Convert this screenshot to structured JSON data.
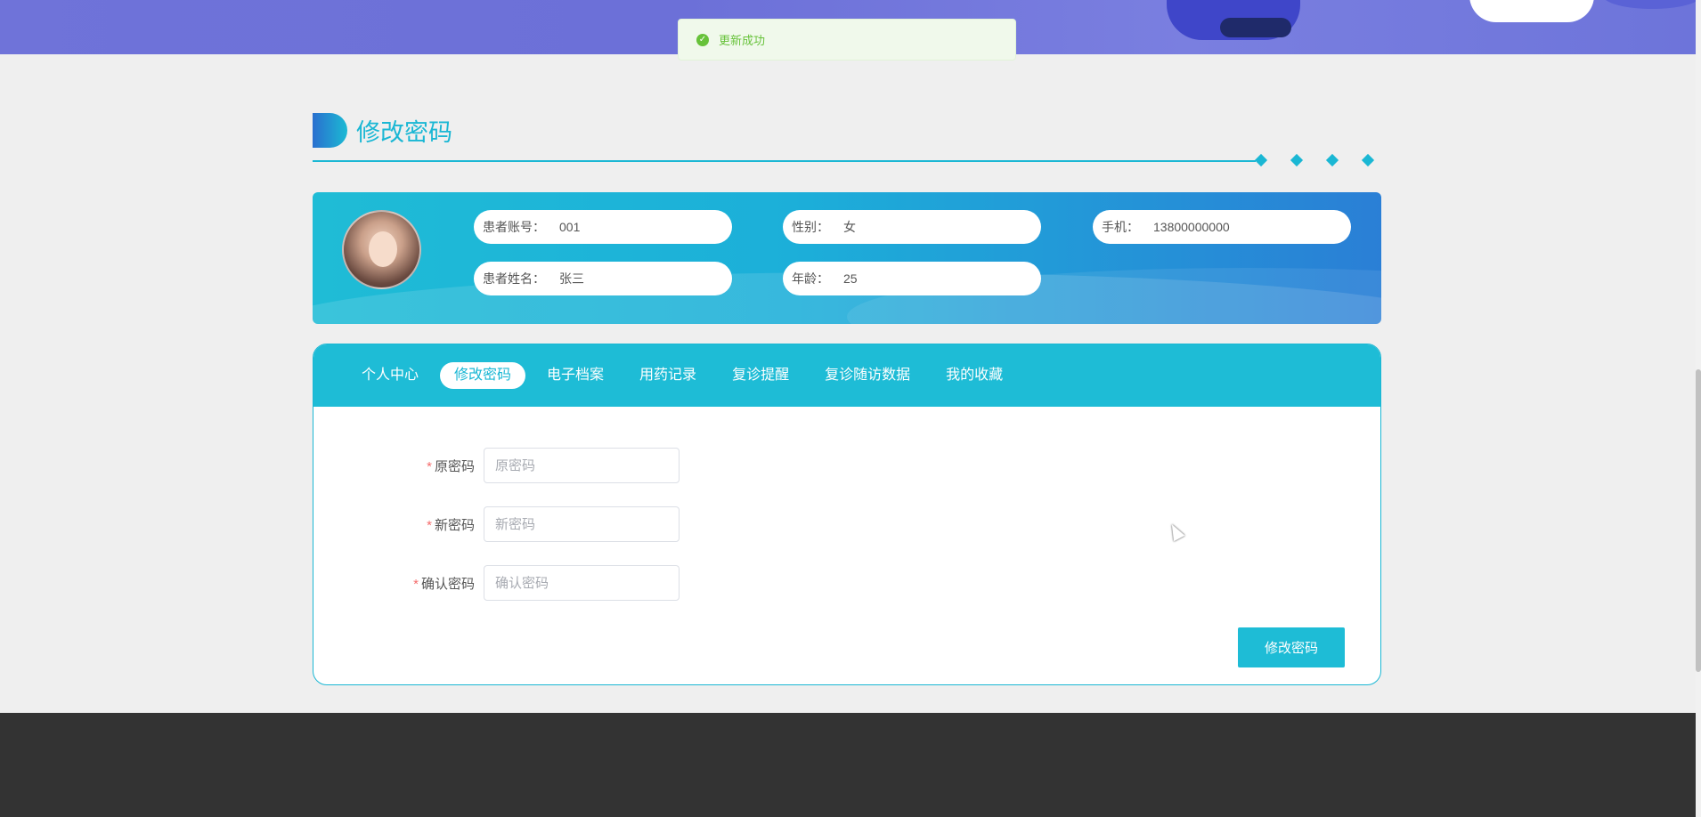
{
  "toast": {
    "message": "更新成功"
  },
  "section": {
    "title": "修改密码"
  },
  "profile": {
    "account_label": "患者账号：",
    "account_value": "001",
    "gender_label": "性别：",
    "gender_value": "女",
    "phone_label": "手机：",
    "phone_value": "13800000000",
    "name_label": "患者姓名：",
    "name_value": "张三",
    "age_label": "年龄：",
    "age_value": "25"
  },
  "tabs": [
    {
      "label": "个人中心"
    },
    {
      "label": "修改密码",
      "active": true
    },
    {
      "label": "电子档案"
    },
    {
      "label": "用药记录"
    },
    {
      "label": "复诊提醒"
    },
    {
      "label": "复诊随访数据"
    },
    {
      "label": "我的收藏"
    }
  ],
  "form": {
    "old_password": {
      "label": "原密码",
      "placeholder": "原密码",
      "value": ""
    },
    "new_password": {
      "label": "新密码",
      "placeholder": "新密码",
      "value": ""
    },
    "confirm_password": {
      "label": "确认密码",
      "placeholder": "确认密码",
      "value": ""
    },
    "required_mark": "*",
    "submit_label": "修改密码"
  },
  "colors": {
    "accent": "#1ab7d4",
    "success": "#67c23a",
    "required": "#f56c6c",
    "footer": "#333333"
  }
}
